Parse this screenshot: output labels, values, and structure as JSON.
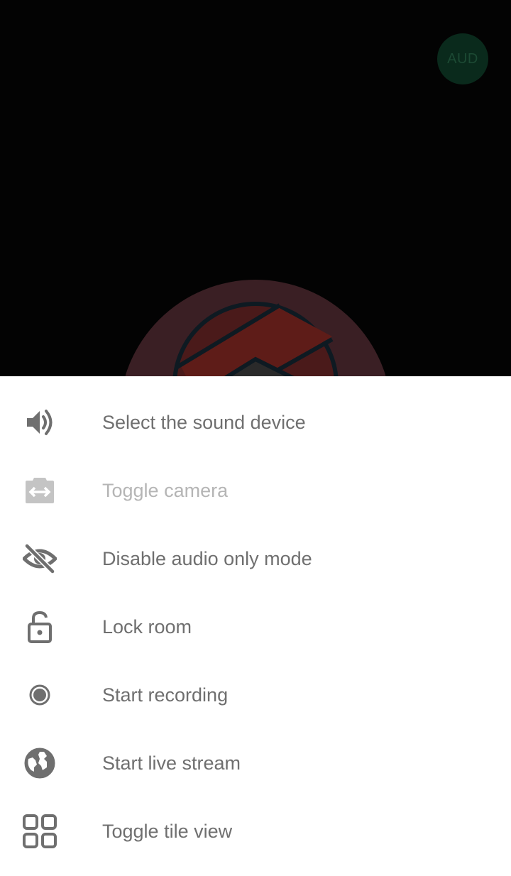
{
  "video": {
    "audio_badge_label": "AUD"
  },
  "menu": {
    "items": [
      {
        "label": "Select the sound device",
        "icon": "speaker-icon",
        "enabled": true
      },
      {
        "label": "Toggle camera",
        "icon": "switch-camera-icon",
        "enabled": false
      },
      {
        "label": "Disable audio only mode",
        "icon": "eye-off-icon",
        "enabled": true
      },
      {
        "label": "Lock room",
        "icon": "lock-open-icon",
        "enabled": true
      },
      {
        "label": "Start recording",
        "icon": "record-icon",
        "enabled": true
      },
      {
        "label": "Start live stream",
        "icon": "globe-icon",
        "enabled": true
      },
      {
        "label": "Toggle tile view",
        "icon": "tile-view-icon",
        "enabled": true
      }
    ]
  },
  "colors": {
    "icon": "#6f6f6f",
    "icon_disabled": "#c4c4c4",
    "label": "#6f6f6f",
    "label_disabled": "#b5b5b5",
    "sheet_background": "#ffffff",
    "video_background": "#030303",
    "audio_badge_background": "#0a2a1c"
  }
}
